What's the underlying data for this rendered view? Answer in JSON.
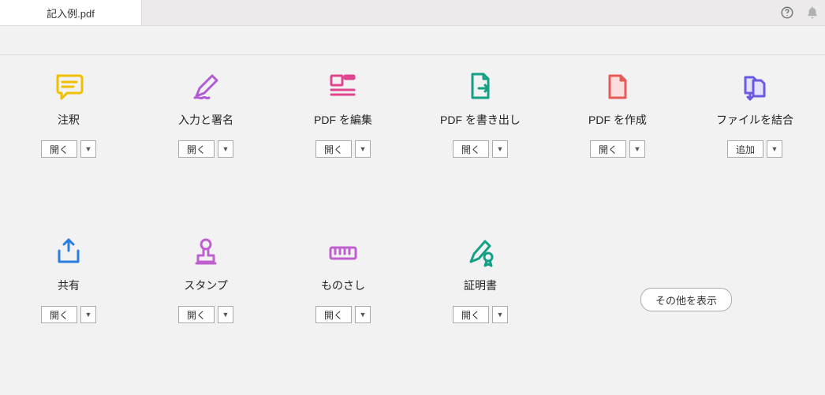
{
  "tab": {
    "title": "記入例.pdf"
  },
  "buttons": {
    "open": "開く",
    "add": "追加",
    "show_more": "その他を表示"
  },
  "tools": {
    "comment": {
      "label": "注釈",
      "btn": "open",
      "icon": "comment-icon",
      "color": "#f0c000"
    },
    "fillsign": {
      "label": "入力と署名",
      "btn": "open",
      "icon": "fill-sign-icon",
      "color": "#b15bd6"
    },
    "editpdf": {
      "label": "PDF を編集",
      "btn": "open",
      "icon": "edit-pdf-icon",
      "color": "#e0458f"
    },
    "exportpdf": {
      "label": "PDF を書き出し",
      "btn": "open",
      "icon": "export-pdf-icon",
      "color": "#13a085"
    },
    "createpdf": {
      "label": "PDF を作成",
      "btn": "open",
      "icon": "create-pdf-icon",
      "color": "#e65a57"
    },
    "combine": {
      "label": "ファイルを結合",
      "btn": "add",
      "icon": "combine-icon",
      "color": "#6a5ae0"
    },
    "share": {
      "label": "共有",
      "btn": "open",
      "icon": "share-icon",
      "color": "#2a7de1"
    },
    "stamp": {
      "label": "スタンプ",
      "btn": "open",
      "icon": "stamp-icon",
      "color": "#c060d0"
    },
    "measure": {
      "label": "ものさし",
      "btn": "open",
      "icon": "measure-icon",
      "color": "#c060d0"
    },
    "cert": {
      "label": "証明書",
      "btn": "open",
      "icon": "certificate-icon",
      "color": "#13a085"
    }
  }
}
